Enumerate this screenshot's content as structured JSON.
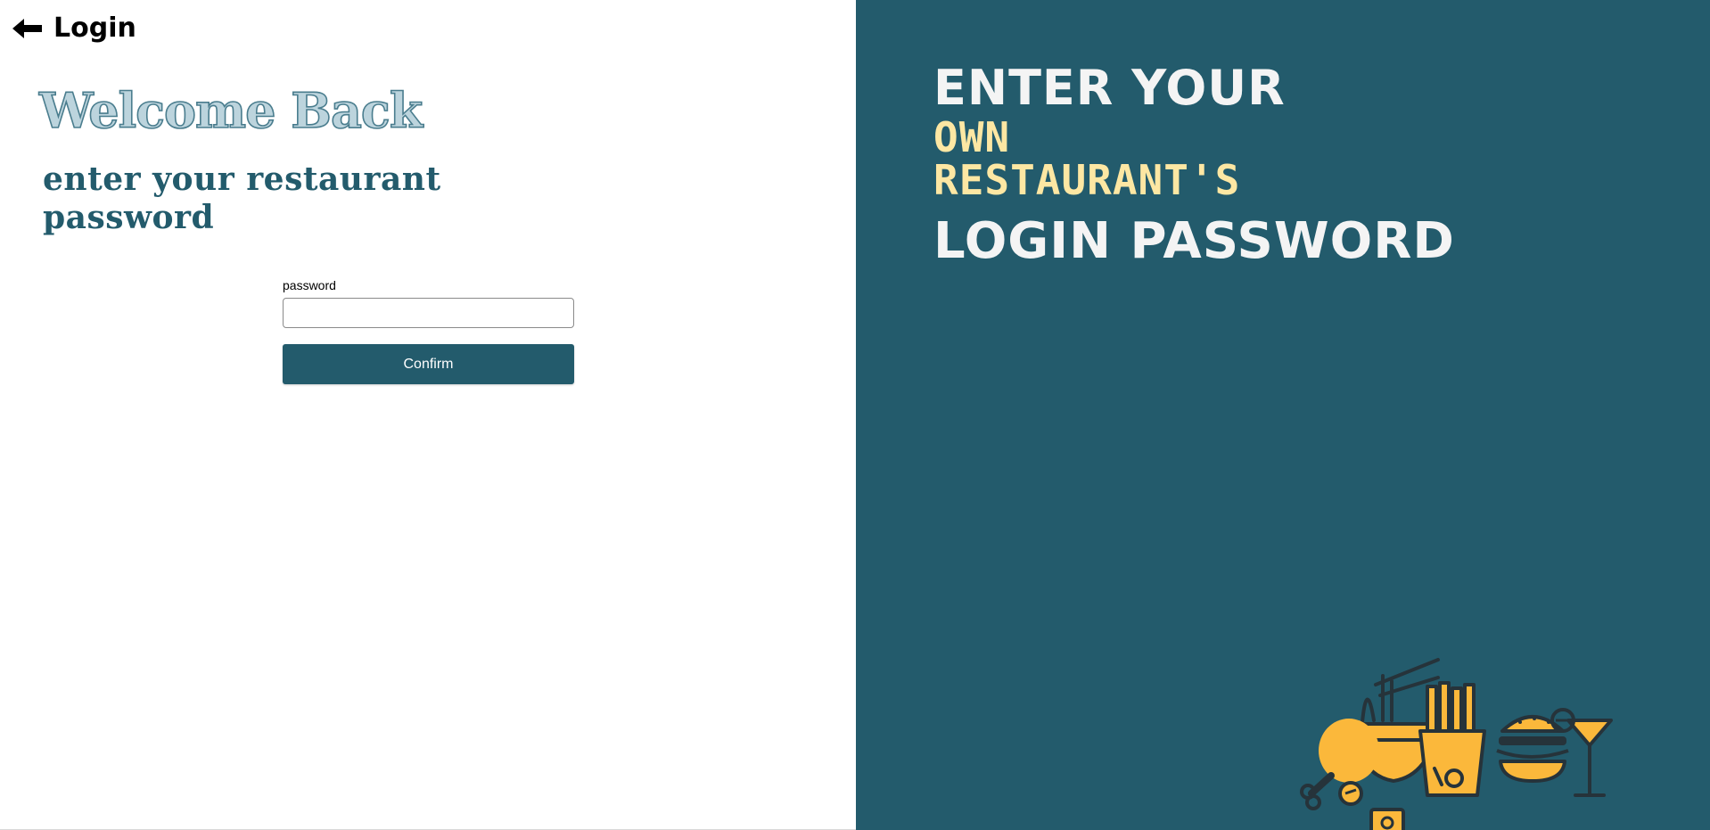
{
  "header": {
    "back_icon": "arrow-left-icon",
    "title": "Login"
  },
  "login": {
    "welcome": "Welcome Back",
    "subtitle": "enter your restaurant password",
    "password_label": "password",
    "password_value": "",
    "password_placeholder": "",
    "confirm_label": "Confirm"
  },
  "hero": {
    "line1": "ENTER YOUR",
    "line2": "OWN",
    "line3": "RESTAURANT'S",
    "line4": "LOGIN PASSWORD"
  },
  "illustration": {
    "icon": "food-illustration-icon"
  },
  "colors": {
    "brand": "#235b6c",
    "accent_yellow": "#fde7a3",
    "food_yellow": "#fbb83b",
    "text_light": "#f4f4f4"
  }
}
